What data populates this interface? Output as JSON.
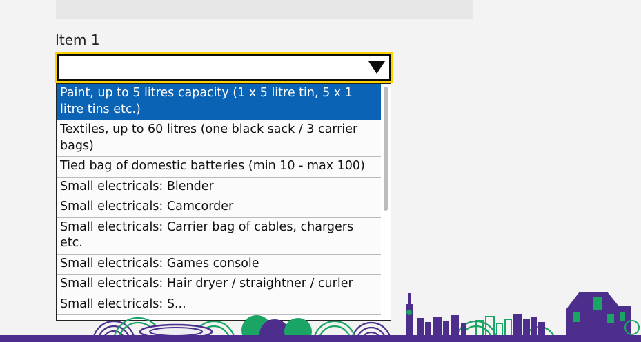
{
  "form": {
    "item_label": "Item 1",
    "selected_value": ""
  },
  "dropdown": {
    "options": [
      "Paint, up to 5 litres capacity (1 x 5 litre tin, 5 x 1 litre tins etc.)",
      "Textiles, up to 60 litres (one black sack / 3 carrier bags)",
      "Tied bag of domestic batteries (min 10 - max 100)",
      "Small electricals: Blender",
      "Small electricals: Camcorder",
      "Small electricals: Carrier bag of cables, chargers etc.",
      "Small electricals: Games console",
      "Small electricals: Hair dryer / straightner / curler",
      "Small electricals: S..."
    ],
    "highlighted_index": 0
  },
  "icons": {
    "select_arrow": "triangle-down-icon"
  },
  "colors": {
    "focus_outline": "#ffd100",
    "highlight": "#0b63b6",
    "footer_purple": "#4d2e8c",
    "footer_green": "#1aa564"
  }
}
